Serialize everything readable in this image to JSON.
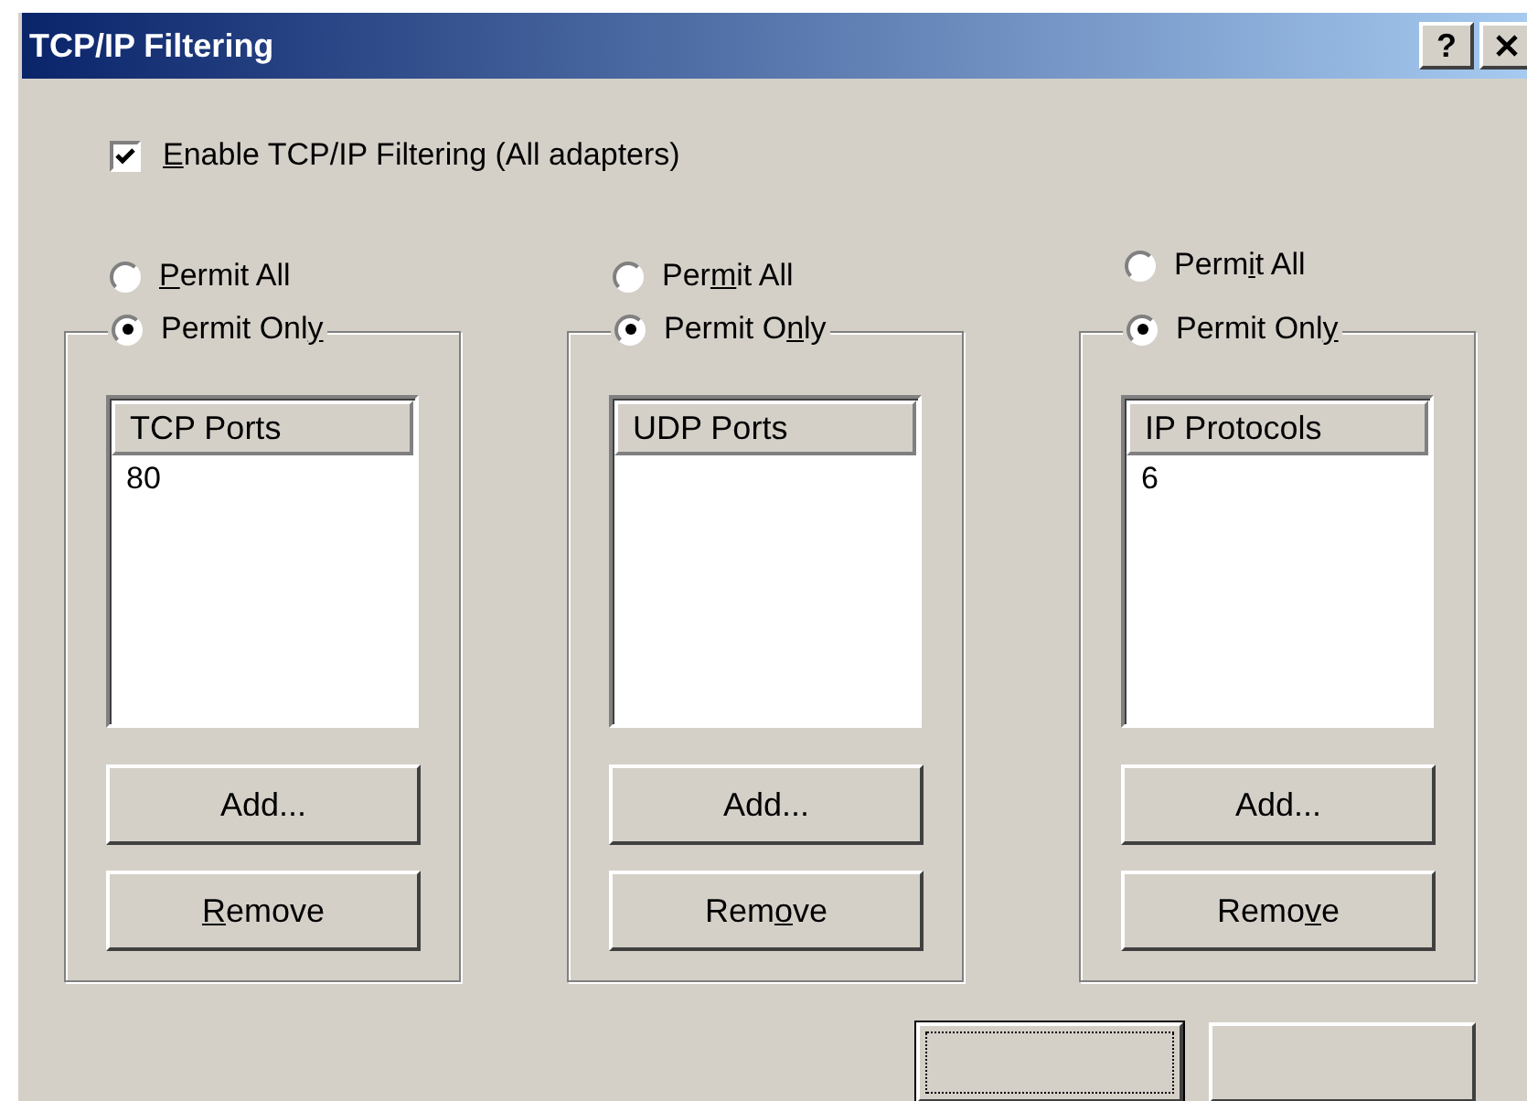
{
  "window": {
    "title": "TCP/IP Filtering",
    "help_button": "?"
  },
  "enable_filtering": {
    "label": {
      "key": "E",
      "post": "nable TCP/IP Filtering (All adapters)"
    },
    "checked": true
  },
  "groups": [
    {
      "permit_all": {
        "label": {
          "key": "P",
          "post": "ermit All"
        },
        "selected": false
      },
      "permit_only": {
        "label": {
          "pre": "Permit Onl",
          "key": "y"
        },
        "selected": true
      },
      "list": {
        "header": "TCP Ports",
        "items": [
          "80"
        ]
      },
      "add_button": {
        "label": {
          "pre": "Add..."
        }
      },
      "remove_button": {
        "label": {
          "key": "R",
          "post": "emove"
        }
      }
    },
    {
      "permit_all": {
        "label": {
          "pre": "Per",
          "key": "m",
          "post": "it All"
        },
        "selected": false
      },
      "permit_only": {
        "label": {
          "pre": "Permit O",
          "key": "n",
          "post": "ly"
        },
        "selected": true
      },
      "list": {
        "header": "UDP Ports"
      },
      "add_button": {
        "label": {
          "pre": "Add..."
        }
      },
      "remove_button": {
        "label": {
          "pre": "Rem",
          "key": "o",
          "post": "ve"
        }
      }
    },
    {
      "permit_all": {
        "label": {
          "pre": "Perm",
          "key": "i",
          "post": "t All"
        },
        "selected": false
      },
      "permit_only": {
        "label": {
          "pre": "Permit Onl",
          "key": "y"
        },
        "selected": true
      },
      "list": {
        "header": "IP Protocols",
        "items": [
          "6"
        ]
      },
      "add_button": {
        "label": {
          "pre": "Add..."
        }
      },
      "remove_button": {
        "label": {
          "pre": "Remo",
          "key": "v",
          "post": "e"
        }
      }
    }
  ],
  "footer_buttons": [
    {
      "kind": "default"
    },
    {
      "kind": "normal"
    }
  ]
}
